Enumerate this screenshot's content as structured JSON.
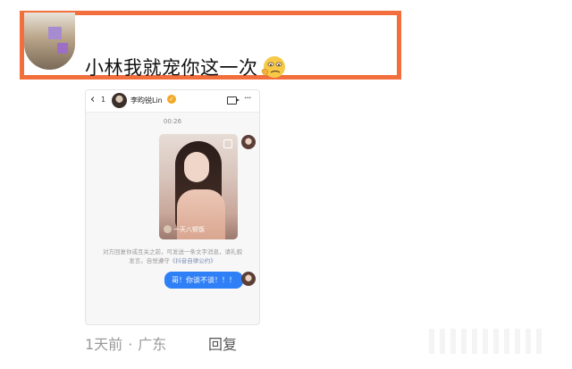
{
  "comment": {
    "text": "小林我就宠你这一次",
    "emoji": "thinking-face-emoji"
  },
  "screenshot": {
    "header": {
      "back_symbol": "‹",
      "count": "1",
      "name": "李昀锐Lin",
      "verified_symbol": "✓",
      "more_symbol": "···"
    },
    "time": "00:26",
    "photo_caption": "一天八顿饭",
    "notice_text": "对方回复你或互关之前，可发送一条文字消息，请礼貌发言。自觉遵守",
    "notice_link": "《抖音自律公约》",
    "message": "哥！你谈不谈！！！"
  },
  "meta": {
    "time": "1天前",
    "separator": "·",
    "location": "广东",
    "reply": "回复"
  },
  "colors": {
    "highlight_border": "#f26f3d",
    "bubble_blue": "#2f7ff7"
  }
}
